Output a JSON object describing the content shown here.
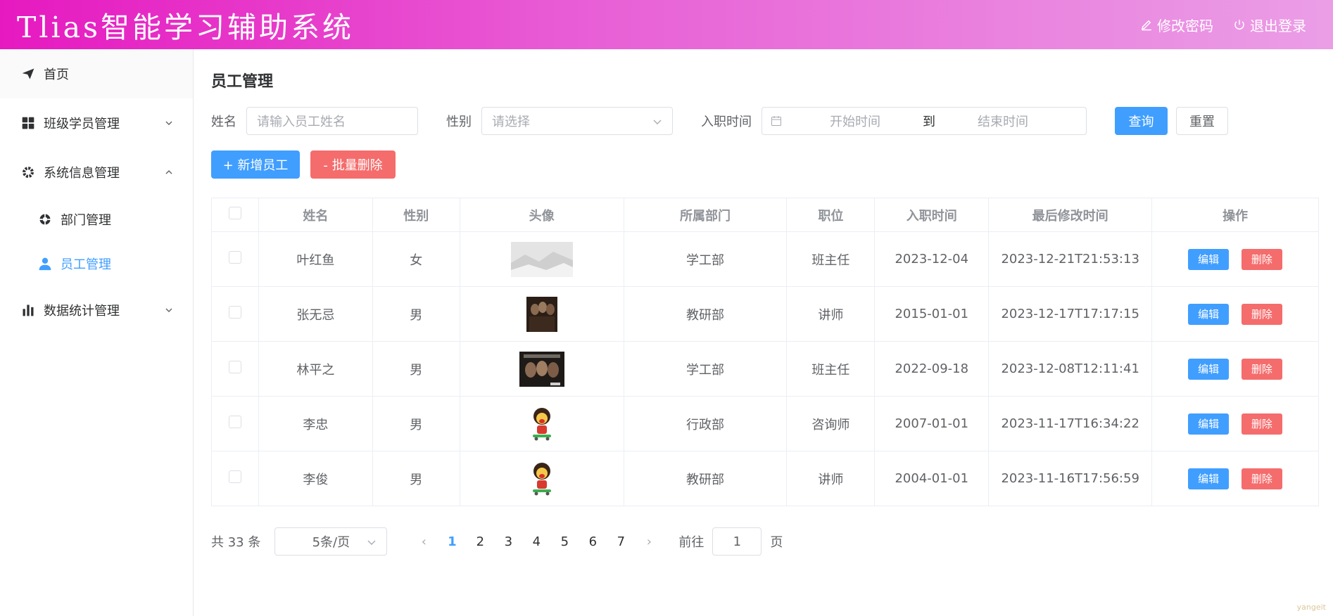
{
  "header": {
    "title": "Tlias智能学习辅助系统",
    "change_password": "修改密码",
    "logout": "退出登录",
    "background_start": "#e619c0",
    "background_end": "#eb9ee6"
  },
  "sidebar": {
    "items": [
      {
        "label": "首页",
        "icon": "send-icon"
      },
      {
        "label": "班级学员管理",
        "icon": "grid-icon"
      },
      {
        "label": "系统信息管理",
        "icon": "gear-icon"
      },
      {
        "label": "部门管理",
        "icon": "help-buoy-icon"
      },
      {
        "label": "员工管理",
        "icon": "user-icon",
        "active": true
      },
      {
        "label": "数据统计管理",
        "icon": "bar-chart-icon"
      }
    ]
  },
  "page": {
    "title": "员工管理"
  },
  "search": {
    "name_label": "姓名",
    "name_placeholder": "请输入员工姓名",
    "gender_label": "性别",
    "gender_placeholder": "请选择",
    "date_label": "入职时间",
    "start_placeholder": "开始时间",
    "range_sep": "到",
    "end_placeholder": "结束时间",
    "query": "查询",
    "reset": "重置"
  },
  "actions": {
    "add": "+ 新增员工",
    "batch_delete": "- 批量删除"
  },
  "table": {
    "columns": [
      "姓名",
      "性别",
      "头像",
      "所属部门",
      "职位",
      "入职时间",
      "最后修改时间",
      "操作"
    ],
    "edit_label": "编辑",
    "delete_label": "删除",
    "rows": [
      {
        "name": "叶红鱼",
        "gender": "女",
        "avatar": "gray-landscape-image",
        "dept": "学工部",
        "job": "班主任",
        "entry": "2023-12-04",
        "updated": "2023-12-21T21:53:13"
      },
      {
        "name": "张无忌",
        "gender": "男",
        "avatar": "movie-poster-image",
        "dept": "教研部",
        "job": "讲师",
        "entry": "2015-01-01",
        "updated": "2023-12-17T17:17:15"
      },
      {
        "name": "林平之",
        "gender": "男",
        "avatar": "movie-poster-image",
        "dept": "学工部",
        "job": "班主任",
        "entry": "2022-09-18",
        "updated": "2023-12-08T12:11:41"
      },
      {
        "name": "李忠",
        "gender": "男",
        "avatar": "cartoon-skater-image",
        "dept": "行政部",
        "job": "咨询师",
        "entry": "2007-01-01",
        "updated": "2023-11-17T16:34:22"
      },
      {
        "name": "李俊",
        "gender": "男",
        "avatar": "cartoon-skater-image",
        "dept": "教研部",
        "job": "讲师",
        "entry": "2004-01-01",
        "updated": "2023-11-16T17:56:59"
      }
    ]
  },
  "pagination": {
    "total_text": "共 33 条",
    "page_size": "5条/页",
    "pages": [
      "1",
      "2",
      "3",
      "4",
      "5",
      "6",
      "7"
    ],
    "current": "1",
    "goto_prefix": "前往",
    "goto_value": "1",
    "goto_suffix": "页"
  },
  "watermark": "yangeit",
  "colors": {
    "primary": "#409eff",
    "danger": "#f56c6c"
  }
}
